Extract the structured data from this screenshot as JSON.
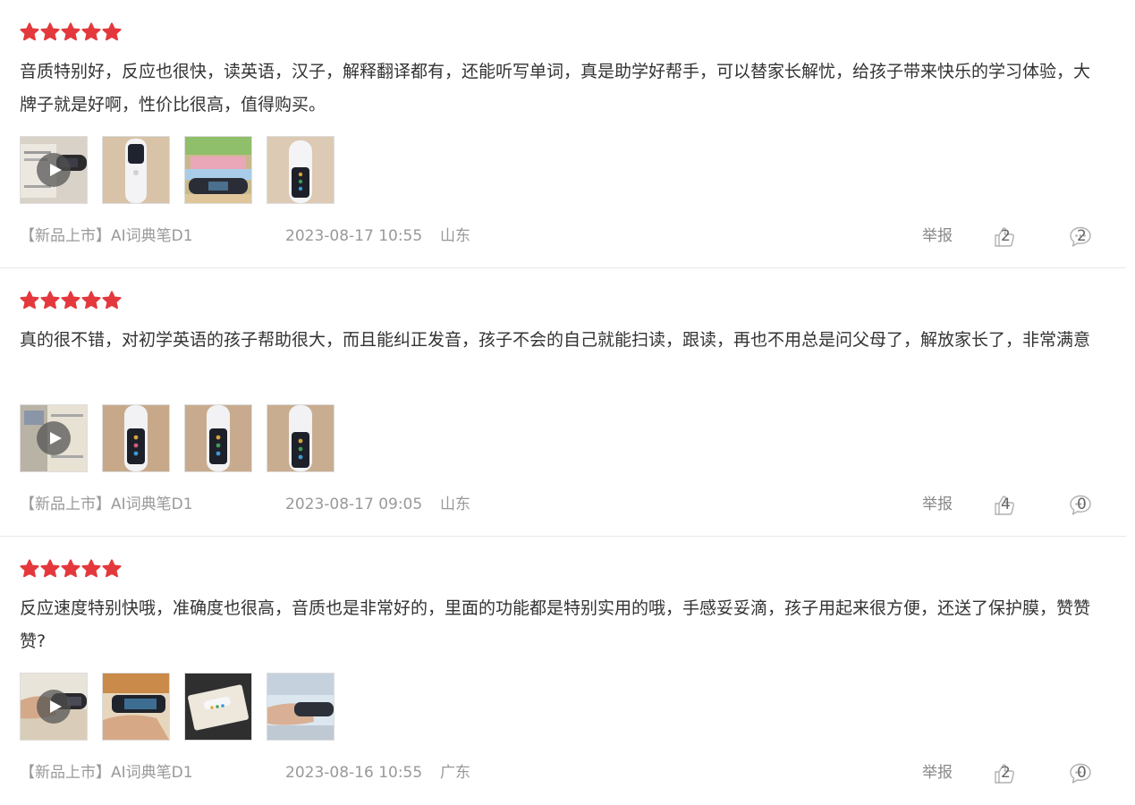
{
  "colors": {
    "star": "#e4393c",
    "text": "#333333",
    "meta": "#999999",
    "divider": "#e8e8e8"
  },
  "icons": {
    "star": "star-icon",
    "play": "play-icon",
    "like": "thumbs-up-icon",
    "comment": "comment-bubble-icon"
  },
  "reviews": [
    {
      "rating": 5,
      "text": "音质特别好，反应也很快，读英语，汉子，解释翻译都有，还能听写单词，真是助学好帮手，可以替家长解忧，给孩子带来快乐的学习体验，大牌子就是好啊，性价比很高，值得购买。",
      "product": "【新品上市】AI词典笔D1",
      "time": "2023-08-17 10:55",
      "region": "山东",
      "report_label": "举报",
      "likes": "2",
      "comments": "2"
    },
    {
      "rating": 5,
      "text": "真的很不错，对初学英语的孩子帮助很大，而且能纠正发音，孩子不会的自己就能扫读，跟读，再也不用总是问父母了，解放家长了，非常满意",
      "product": "【新品上市】AI词典笔D1",
      "time": "2023-08-17 09:05",
      "region": "山东",
      "report_label": "举报",
      "likes": "4",
      "comments": "0"
    },
    {
      "rating": 5,
      "text": "反应速度特别快哦，准确度也很高，音质也是非常好的，里面的功能都是特别实用的哦，手感妥妥滴，孩子用起来很方便，还送了保护膜，赞赞赞?",
      "product": "【新品上市】AI词典笔D1",
      "time": "2023-08-16 10:55",
      "region": "广东",
      "report_label": "举报",
      "likes": "2",
      "comments": "0"
    }
  ]
}
